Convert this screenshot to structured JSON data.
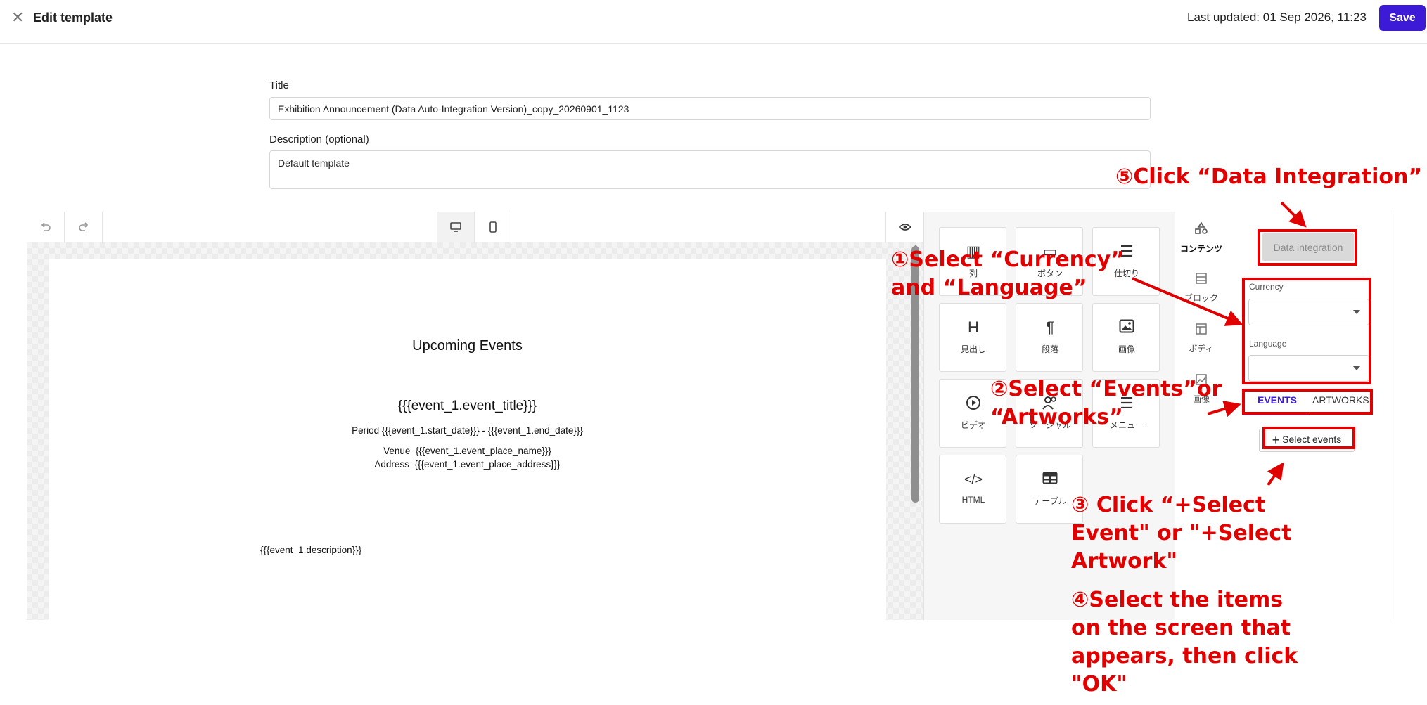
{
  "header": {
    "close_icon": "close-icon",
    "title": "Edit template",
    "last_updated": "Last updated: 01 Sep 2026, 11:23",
    "save_label": "Save"
  },
  "form": {
    "title_label": "Title",
    "title_value": "Exhibition Announcement (Data Auto-Integration Version)_copy_20260901_1123",
    "description_label": "Description (optional)",
    "description_value": "Default template"
  },
  "editor_toolbar": {
    "icons": [
      "undo-icon",
      "redo-icon",
      "desktop-view-icon",
      "mobile-view-icon",
      "preview-eye-icon"
    ]
  },
  "canvas": {
    "heading": "Upcoming Events",
    "event_title": "{{{event_1.event_title}}}",
    "period": "Period {{{event_1.start_date}}} - {{{event_1.end_date}}}",
    "venue": "Venue  {{{event_1.event_place_name}}}",
    "address": "Address  {{{event_1.event_place_address}}}",
    "description": "{{{event_1.description}}}"
  },
  "blocks": [
    {
      "label": "列",
      "icon": "columns-icon"
    },
    {
      "label": "ボタン",
      "icon": "button-icon"
    },
    {
      "label": "仕切り",
      "icon": "divider-icon"
    },
    {
      "label": "見出し",
      "icon": "heading-icon"
    },
    {
      "label": "段落",
      "icon": "paragraph-icon"
    },
    {
      "label": "画像",
      "icon": "image-icon"
    },
    {
      "label": "ビデオ",
      "icon": "video-icon"
    },
    {
      "label": "ソーシャル",
      "icon": "social-icon"
    },
    {
      "label": "メニュー",
      "icon": "menu-icon"
    },
    {
      "label": "HTML",
      "icon": "html-icon"
    },
    {
      "label": "テーブル",
      "icon": "table-icon"
    }
  ],
  "side_tabs": [
    {
      "label": "コンテンツ",
      "icon": "shapes-icon"
    },
    {
      "label": "ブロック",
      "icon": "blocks-icon"
    },
    {
      "label": "ボディ",
      "icon": "body-layout-icon"
    },
    {
      "label": "画像",
      "icon": "image-icon"
    }
  ],
  "data_panel": {
    "button_label": "Data integration",
    "currency_label": "Currency",
    "currency_value": "",
    "language_label": "Language",
    "language_value": "",
    "tabs": [
      "EVENTS",
      "ARTWORKS"
    ],
    "active_tab": "EVENTS",
    "accent_color": "#3d1ad6",
    "add_label": "Select events"
  },
  "annotations": {
    "step5": "⑤Click “Data Integration”",
    "step1_line1": "①Select “Currency”",
    "step1_line2": "and “Language”",
    "step2_line1": "②Select “Events”or",
    "step2_line2": "“Artworks”",
    "step3_line1": "③ Click “+Select",
    "step3_line2": "Event\" or \"+Select",
    "step3_line3": "Artwork\"",
    "step4_line1": "④Select the items",
    "step4_line2": "on the screen that",
    "step4_line3": "appears, then click",
    "step4_line4": "\"OK\"",
    "color": "#e00000"
  }
}
